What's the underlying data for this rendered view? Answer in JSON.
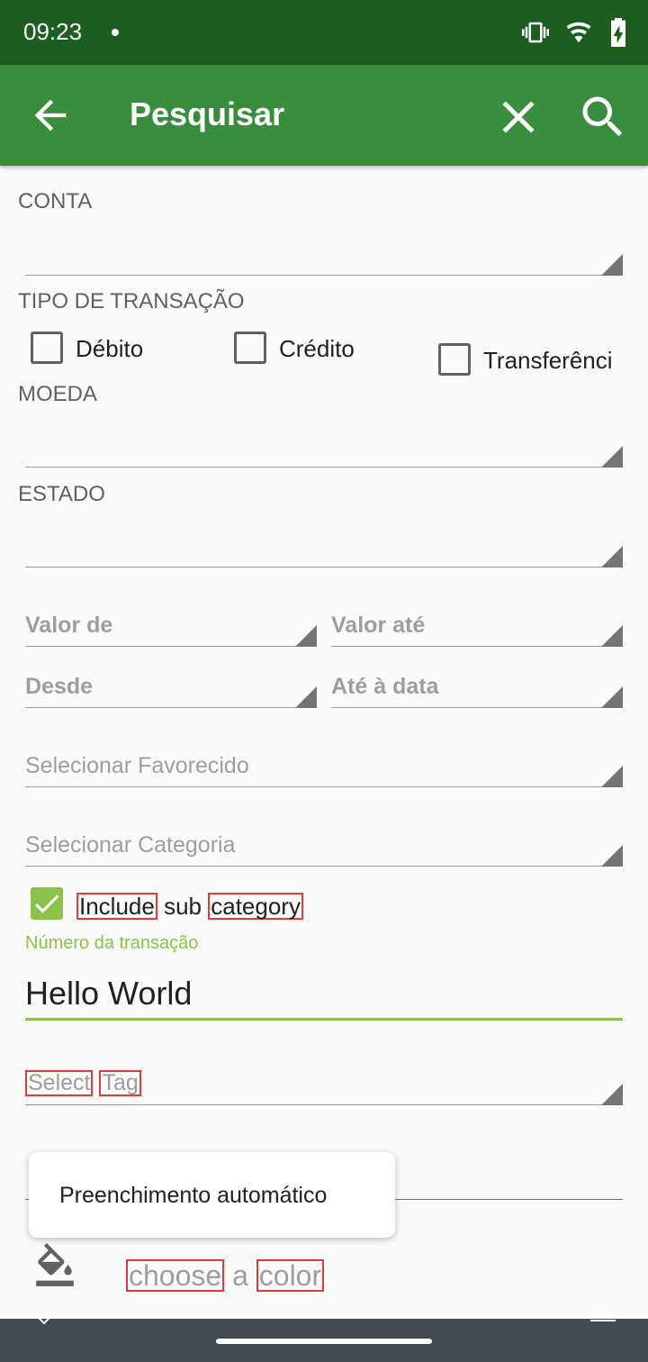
{
  "status_bar": {
    "time": "09:23"
  },
  "app_bar": {
    "title": "Pesquisar"
  },
  "form": {
    "account_label": "CONTA",
    "transaction_type_label": "TIPO DE TRANSAÇÃO",
    "transaction_types": [
      {
        "label": "Débito",
        "checked": false
      },
      {
        "label": "Crédito",
        "checked": false
      },
      {
        "label": "Transferênci",
        "checked": false
      }
    ],
    "currency_label": "MOEDA",
    "status_label": "ESTADO",
    "amount_from": "Valor de",
    "amount_to": "Valor até",
    "date_from": "Desde",
    "date_to": "Até à data",
    "payee_placeholder": "Selecionar Favorecido",
    "category_placeholder": "Selecionar Categoria",
    "include_sub": {
      "word1": "Include",
      "word2": "sub",
      "word3": "category",
      "checked": true
    },
    "transaction_number_label": "Número da transação",
    "transaction_number_value": "Hello World",
    "tag": {
      "word1": "Select",
      "word2": "Tag"
    },
    "color": {
      "word1": "choose",
      "word2": "a",
      "word3": "color"
    }
  },
  "autofill_popup": {
    "label": "Preenchimento automático"
  },
  "colors": {
    "status_bar": "#1b5e20",
    "app_bar": "#388e3c",
    "accent": "#8bc34a"
  }
}
